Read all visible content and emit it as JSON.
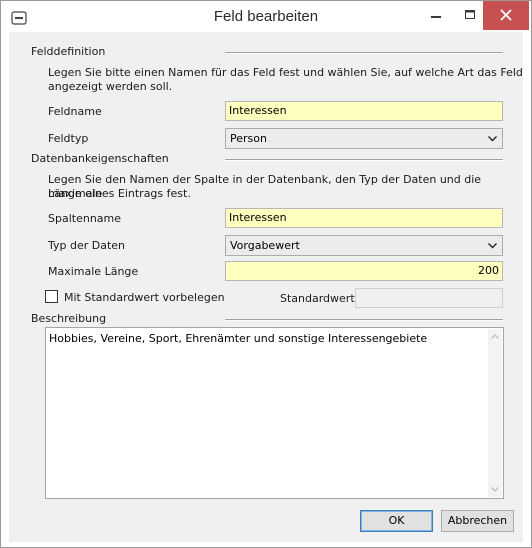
{
  "window": {
    "title": "Feld bearbeiten"
  },
  "feld": {
    "section": "Felddefinition",
    "description_line1": "Legen Sie bitte einen Namen für das Feld fest und wählen Sie, auf welche Art das Feld",
    "description_line2": "angezeigt werden soll.",
    "name_label": "Feldname",
    "name_value": "Interessen",
    "type_label": "Feldtyp",
    "type_value": "Person"
  },
  "db": {
    "section": "Datenbankeigenschaften",
    "description_line1": "Legen Sie den Namen der Spalte in der Datenbank, den Typ der Daten und die maximale",
    "description_line2": "Länge eines Eintrags fest.",
    "column_label": "Spaltenname",
    "column_value": "Interessen",
    "datatype_label": "Typ der Daten",
    "datatype_value": "Vorgabewert",
    "maxlen_label": "Maximale Länge",
    "maxlen_value": "200",
    "default_checkbox_label": "Mit Standardwert vorbelegen",
    "default_checked": false,
    "default_label": "Standardwert",
    "default_value": ""
  },
  "beschreibung": {
    "section": "Beschreibung",
    "text": "Hobbies, Vereine, Sport, Ehrenämter und sonstige Interessengebiete"
  },
  "buttons": {
    "ok": "OK",
    "cancel": "Abbrechen"
  },
  "icons": {
    "app": "form-field-icon",
    "minimize": "minimize-icon",
    "maximize": "maximize-icon",
    "close": "close-icon",
    "dropdown": "chevron-down-icon"
  },
  "colors": {
    "input_highlight": "#ffffc0",
    "close_button": "#c75050",
    "default_button_border": "#3c7fb1"
  }
}
